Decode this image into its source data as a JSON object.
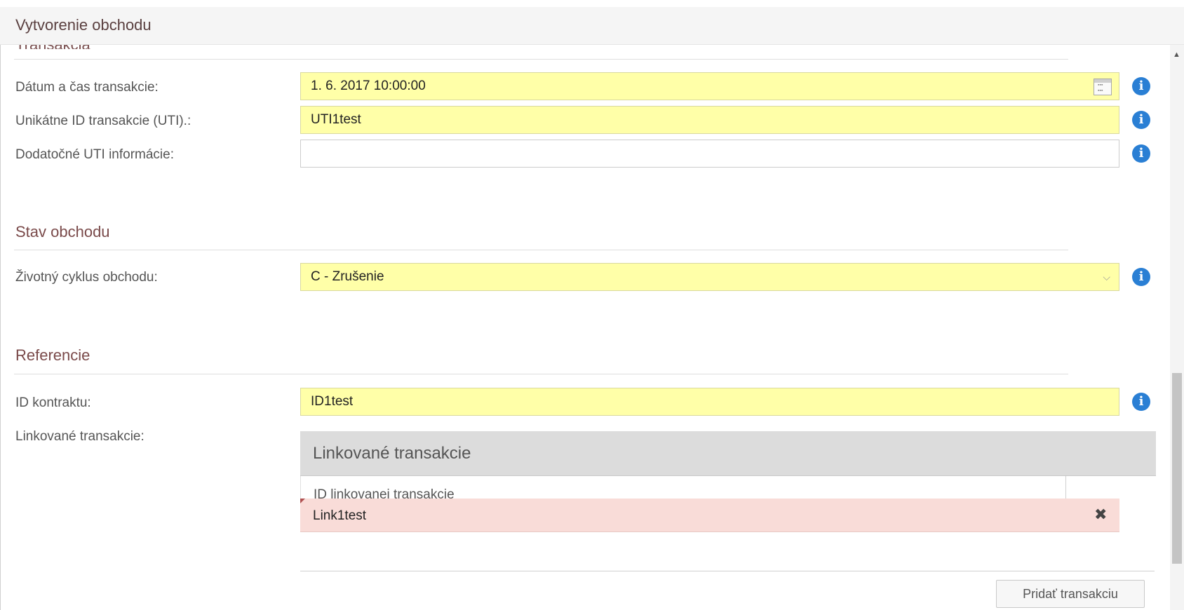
{
  "window": {
    "title": "Vytvorenie obchodu"
  },
  "transaction": {
    "section_label": "Transakcia",
    "datetime_label": "Dátum a čas transakcie:",
    "datetime_value": "1. 6. 2017 10:00:00",
    "uti_label": "Unikátne ID transakcie (UTI).:",
    "uti_value": "UTI1test",
    "uti_extra_label": "Dodatočné UTI informácie:",
    "uti_extra_value": ""
  },
  "trade_status": {
    "heading": "Stav obchodu",
    "lifecycle_label": "Životný cyklus obchodu:",
    "lifecycle_value": "C - Zrušenie"
  },
  "references": {
    "heading": "Referencie",
    "contract_label": "ID kontraktu:",
    "contract_value": "ID1test",
    "linked_label": "Linkované transakcie:",
    "linked_table": {
      "title": "Linkované transakcie",
      "column_header": "ID linkovanej transakcie",
      "rows": [
        {
          "id": "Link1test"
        }
      ],
      "add_button": "Pridať transakciu"
    }
  },
  "icons": {
    "info": "info-circle-icon",
    "calendar": "calendar-icon",
    "dropdown": "chevron-down-icon",
    "delete": "close-x-icon"
  },
  "colors": {
    "required_field_bg": "#ffffa8",
    "error_row_bg": "#f9dcd8",
    "info_icon": "#2a7fd4",
    "heading_text": "#7a4a4a"
  }
}
